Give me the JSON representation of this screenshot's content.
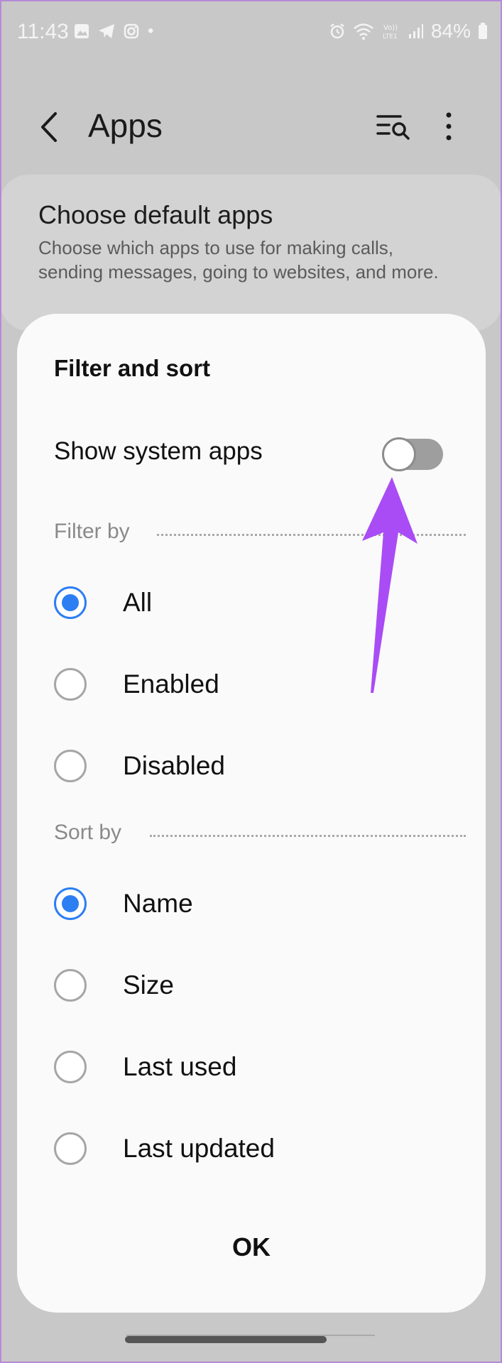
{
  "status_bar": {
    "time": "11:43",
    "battery": "84%",
    "left_icons": [
      "gallery-icon",
      "telegram-icon",
      "instagram-icon",
      "dot-icon"
    ],
    "right_icons": [
      "alarm-icon",
      "wifi-icon",
      "volte-icon",
      "signal-icon",
      "battery-icon"
    ]
  },
  "app_bar": {
    "title": "Apps",
    "back_icon": "back-arrow-icon",
    "search_icon": "filter-search-icon",
    "more_icon": "more-vertical-icon"
  },
  "background_card": {
    "title": "Choose default apps",
    "description": "Choose which apps to use for making calls, sending messages, going to websites, and more."
  },
  "dialog": {
    "title": "Filter and sort",
    "toggle": {
      "label": "Show system apps",
      "on": false
    },
    "filter_section": {
      "label": "Filter by",
      "options": [
        {
          "label": "All",
          "selected": true
        },
        {
          "label": "Enabled",
          "selected": false
        },
        {
          "label": "Disabled",
          "selected": false
        }
      ]
    },
    "sort_section": {
      "label": "Sort by",
      "options": [
        {
          "label": "Name",
          "selected": true
        },
        {
          "label": "Size",
          "selected": false
        },
        {
          "label": "Last used",
          "selected": false
        },
        {
          "label": "Last updated",
          "selected": false
        }
      ]
    },
    "ok_label": "OK"
  },
  "colors": {
    "accent": "#2d7ef2",
    "annotation_arrow": "#a94cf5",
    "dim_background": "#c8c8c8"
  }
}
